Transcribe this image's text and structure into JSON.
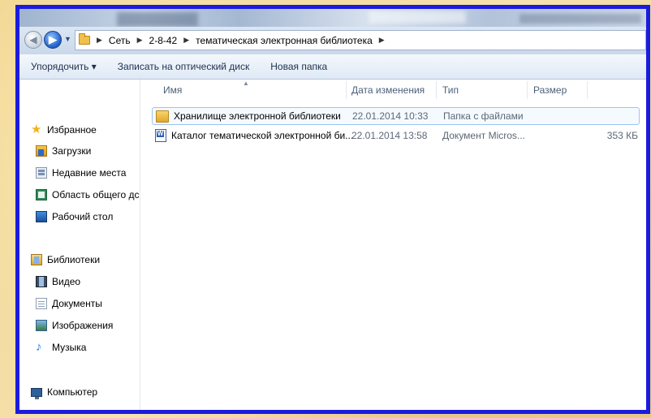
{
  "address": {
    "crumbs": [
      "Сеть",
      "2-8-42",
      "тематическая электронная библиотека"
    ]
  },
  "toolbar": {
    "organize": "Упорядочить ▾",
    "burn": "Записать на оптический диск",
    "new_folder": "Новая папка"
  },
  "sidebar": {
    "favorites": "Избранное",
    "downloads": "Загрузки",
    "recent": "Недавние места",
    "shared": "Область общего дс",
    "desktop": "Рабочий стол",
    "libraries": "Библиотеки",
    "video": "Видео",
    "documents": "Документы",
    "images": "Изображения",
    "music": "Музыка",
    "computer": "Компьютер"
  },
  "columns": {
    "name": "Имя",
    "date": "Дата изменения",
    "type": "Тип",
    "size": "Размер"
  },
  "files": [
    {
      "name": "Хранилище электронной библиотеки",
      "date": "22.01.2014 10:33",
      "type": "Папка с файлами",
      "size": "",
      "icon": "folder-icon"
    },
    {
      "name": "Каталог тематической электронной би...",
      "date": "22.01.2014 13:58",
      "type": "Документ Micros...",
      "size": "353 КБ",
      "icon": "word-document-icon"
    }
  ]
}
